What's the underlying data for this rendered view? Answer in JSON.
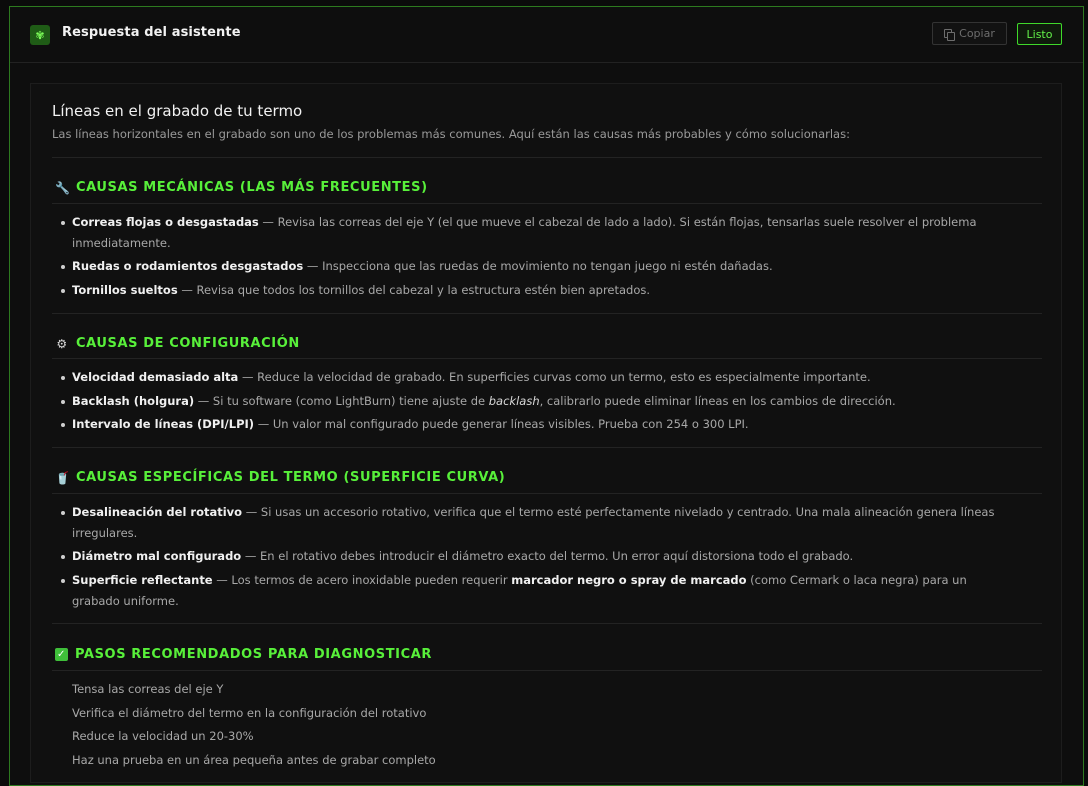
{
  "header": {
    "title": "Respuesta del asistente",
    "copy_label": "Copiar",
    "done_label": "Listo"
  },
  "article": {
    "title": "Líneas en el grabado de tu termo",
    "intro": "Las líneas horizontales en el grabado son uno de los problemas más comunes. Aquí están las causas más probables y cómo solucionarlas:",
    "sections": [
      {
        "icon": "wrench-icon",
        "title": "CAUSAS MECÁNICAS (LAS MÁS FRECUENTES)",
        "items": [
          {
            "strong": "Correas flojas o desgastadas",
            "text": " — Revisa las correas del eje Y (el que mueve el cabezal de lado a lado). Si están flojas, tensarlas suele resolver el problema inmediatamente."
          },
          {
            "strong": "Ruedas o rodamientos desgastados",
            "text": " — Inspecciona que las ruedas de movimiento no tengan juego ni estén dañadas."
          },
          {
            "strong": "Tornillos sueltos",
            "text": " — Revisa que todos los tornillos del cabezal y la estructura estén bien apretados."
          }
        ]
      },
      {
        "icon": "gear-icon",
        "title": "CAUSAS DE CONFIGURACIÓN",
        "items": [
          {
            "strong": "Velocidad demasiado alta",
            "text": " — Reduce la velocidad de grabado. En superficies curvas como un termo, esto es especialmente importante."
          },
          {
            "strong": "Backlash (holgura)",
            "text_pre": " — Si tu software (como LightBurn) tiene ajuste de ",
            "em": "backlash",
            "text_post": ", calibrarlo puede eliminar líneas en los cambios de dirección."
          },
          {
            "strong": "Intervalo de líneas (DPI/LPI)",
            "text": " — Un valor mal configurado puede generar líneas visibles. Prueba con 254 o 300 LPI."
          }
        ]
      },
      {
        "icon": "cup-icon",
        "title": "CAUSAS ESPECÍFICAS DEL TERMO (SUPERFICIE CURVA)",
        "items": [
          {
            "strong": "Desalineación del rotativo",
            "text": " — Si usas un accesorio rotativo, verifica que el termo esté perfectamente nivelado y centrado. Una mala alineación genera líneas irregulares."
          },
          {
            "strong": "Diámetro mal configurado",
            "text": " — En el rotativo debes introducir el diámetro exacto del termo. Un error aquí distorsiona todo el grabado."
          },
          {
            "strong": "Superficie reflectante",
            "text_pre": " — Los termos de acero inoxidable pueden requerir ",
            "strong2": "marcador negro o spray de marcado",
            "text_post": " (como Cermark o laca negra) para un grabado uniforme."
          }
        ]
      },
      {
        "icon": "check-icon",
        "title": "PASOS RECOMENDADOS PARA DIAGNOSTICAR",
        "steps": [
          "Tensa las correas del eje Y",
          "Verifica el diámetro del termo en la configuración del rotativo",
          "Reduce la velocidad un 20-30%",
          "Haz una prueba en un área pequeña antes de grabar completo"
        ]
      }
    ]
  }
}
